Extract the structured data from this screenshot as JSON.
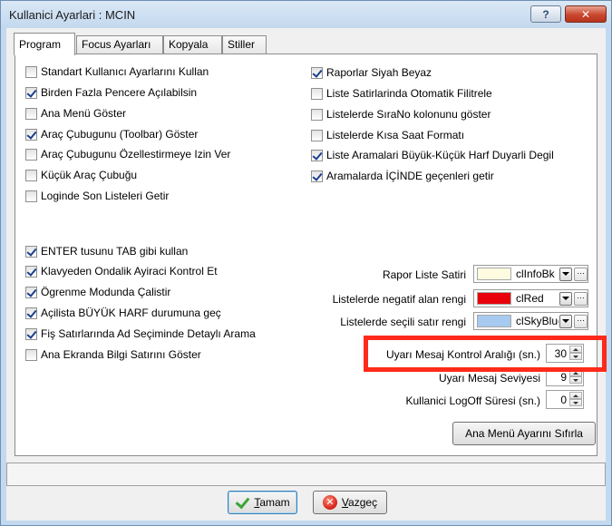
{
  "window": {
    "title": "Kullanici Ayarlari : MCIN",
    "help_label": "?",
    "close_label": "✕"
  },
  "tabs": [
    "Program",
    "Focus Ayarları",
    "Kopyala",
    "Stiller"
  ],
  "left_checkboxes": [
    {
      "label": "Standart Kullanıcı Ayarlarını Kullan",
      "checked": false
    },
    {
      "label": "Birden Fazla Pencere Açılabilsin",
      "checked": true
    },
    {
      "label": "Ana Menü Göster",
      "checked": false
    },
    {
      "label": "Araç Çubugunu (Toolbar) Göster",
      "checked": true
    },
    {
      "label": "Araç Çubugunu Özellestirmeye Izin Ver",
      "checked": false
    },
    {
      "label": "Küçük Araç Çubuğu",
      "checked": false
    },
    {
      "label": "Loginde Son Listeleri Getir",
      "checked": false
    }
  ],
  "right_checkboxes": [
    {
      "label": "Raporlar Siyah Beyaz",
      "checked": true
    },
    {
      "label": "Liste Satirlarinda Otomatik Filitrele",
      "checked": false
    },
    {
      "label": "Listelerde SıraNo kolonunu göster",
      "checked": false
    },
    {
      "label": "Listelerde Kısa Saat Formatı",
      "checked": false
    },
    {
      "label": "Liste Aramalari Büyük-Küçük Harf Duyarli Degil",
      "checked": true
    },
    {
      "label": "Aramalarda İÇİNDE geçenleri getir",
      "checked": true
    }
  ],
  "lower_checkboxes": [
    {
      "label": "ENTER tusunu TAB gibi kullan",
      "checked": true
    },
    {
      "label": "Klavyeden Ondalik Ayiraci Kontrol Et",
      "checked": true
    },
    {
      "label": "Ögrenme Modunda Çalistir",
      "checked": true
    },
    {
      "label": "Açilista BÜYÜK HARF durumuna geç",
      "checked": true
    },
    {
      "label": "Fiş Satırlarında Ad Seçiminde Detaylı Arama",
      "checked": true
    },
    {
      "label": "Ana Ekranda Bilgi Satırını Göster",
      "checked": false
    }
  ],
  "colors": [
    {
      "label": "Rapor Liste Satiri",
      "value": "clInfoBk",
      "hex": "#fffbe0"
    },
    {
      "label": "Listelerde negatif alan rengi",
      "value": "clRed",
      "hex": "#e8000b"
    },
    {
      "label": "Listelerde seçili satır rengi",
      "value": "clSkyBlue",
      "hex": "#a6caf0"
    }
  ],
  "spinners": [
    {
      "label": "Uyarı Mesaj Kontrol Aralığı (sn.)",
      "value": "30"
    },
    {
      "label": "Uyarı Mesaj Seviyesi",
      "value": "9"
    },
    {
      "label": "Kullanici LogOff Süresi (sn.)",
      "value": "0"
    }
  ],
  "buttons": {
    "reset_menu": "Ana Menü Ayarını Sıfırla",
    "ok_underline": "T",
    "ok_rest": "amam",
    "cancel_underline": "V",
    "cancel_rest": "azgeç"
  },
  "status_text": "",
  "highlight_color": "#ff2a1a"
}
